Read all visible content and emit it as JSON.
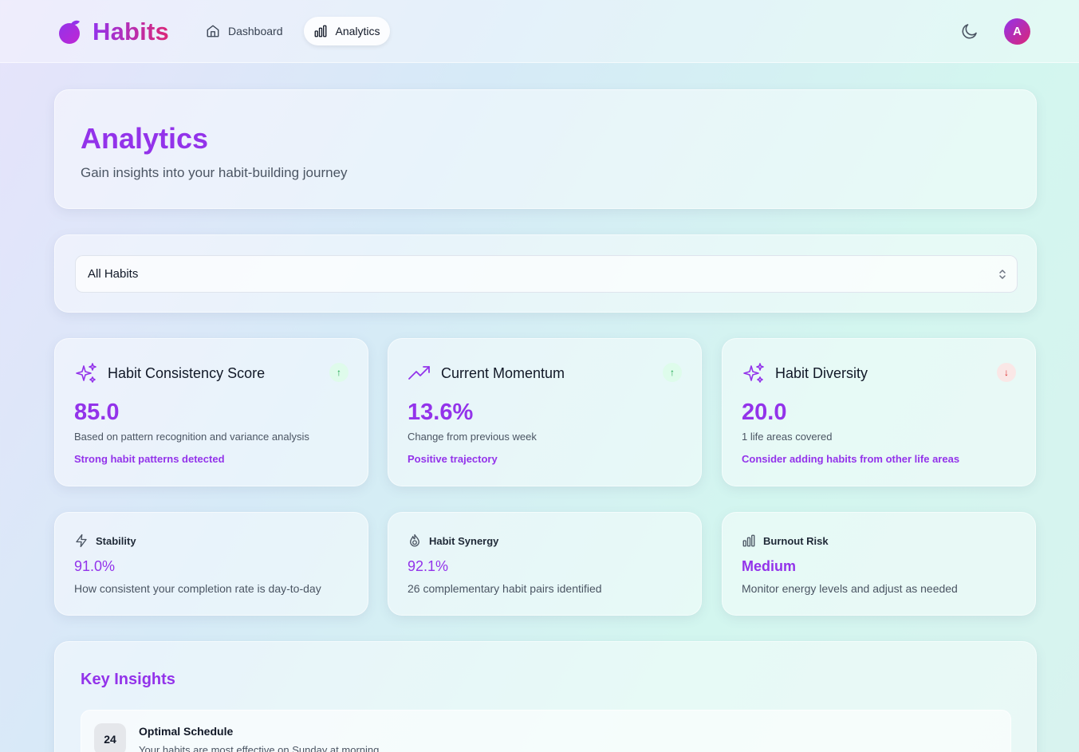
{
  "header": {
    "brand": "Habits",
    "nav": [
      {
        "label": "Dashboard",
        "icon": "home-icon"
      },
      {
        "label": "Analytics",
        "icon": "bar-chart-icon",
        "active": true
      }
    ],
    "avatar_initial": "A",
    "accent": "#9333ea"
  },
  "hero": {
    "title": "Analytics",
    "subtitle": "Gain insights into your habit-building journey"
  },
  "filter": {
    "selected": "All Habits"
  },
  "metrics": [
    {
      "title": "Habit Consistency Score",
      "value": "85.0",
      "description": "Based on pattern recognition and variance analysis",
      "note": "Strong habit patterns detected",
      "trend": "↑",
      "icon": "sparkles-icon"
    },
    {
      "title": "Current Momentum",
      "value": "13.6%",
      "description": "Change from previous week",
      "note": "Positive trajectory",
      "trend": "↑",
      "icon": "trending-up-icon"
    },
    {
      "title": "Habit Diversity",
      "value": "20.0",
      "description": "1 life areas covered",
      "note": "Consider adding habits from other life areas",
      "trend": "↓",
      "icon": "sparkles-icon"
    }
  ],
  "stats": [
    {
      "title": "Stability",
      "value": "91.0%",
      "description": "How consistent your completion rate is day-to-day",
      "icon": "zap-icon"
    },
    {
      "title": "Habit Synergy",
      "value": "92.1%",
      "description": "26 complementary habit pairs identified",
      "icon": "flame-icon"
    },
    {
      "title": "Burnout Risk",
      "value": "Medium",
      "description": "Monitor energy levels and adjust as needed",
      "icon": "bar-chart-icon"
    }
  ],
  "insights": {
    "title": "Key Insights",
    "items": [
      {
        "badge": "24",
        "title": "Optimal Schedule",
        "description": "Your habits are most effective on Sunday at morning"
      }
    ]
  }
}
